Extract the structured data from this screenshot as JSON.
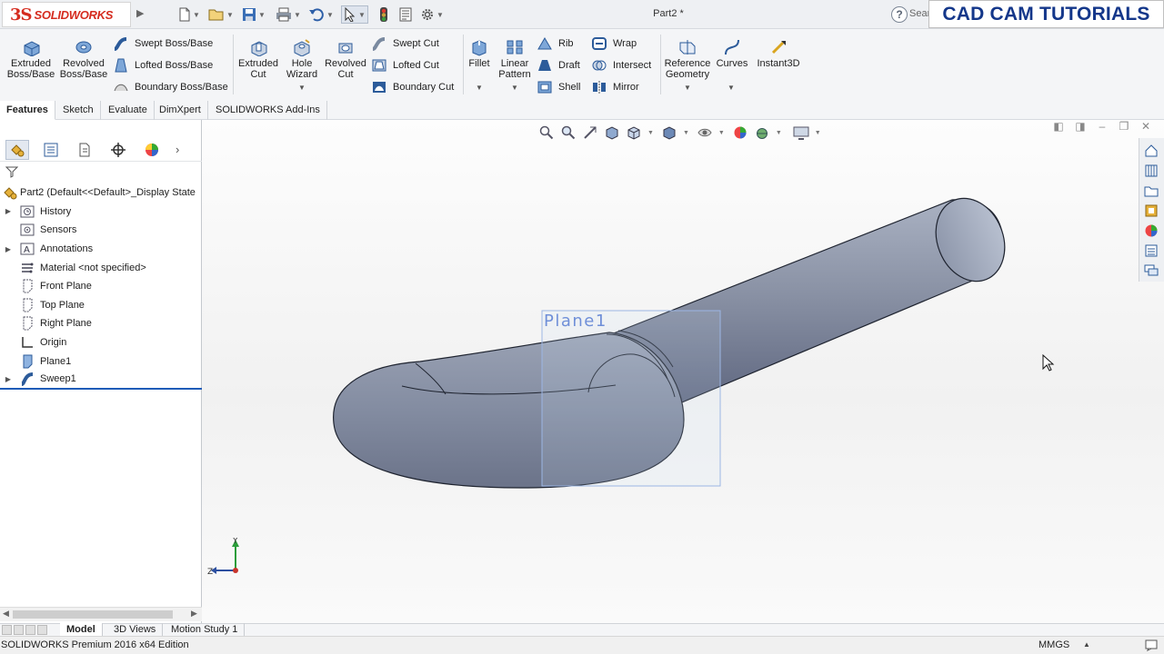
{
  "titlebar": {
    "logo_ds": "3S",
    "logo_name": "SOLIDWORKS",
    "document_title": "Part2 *",
    "search_text": "Sear",
    "banner": "CAD CAM TUTORIALS"
  },
  "ribbon": {
    "extruded_boss": [
      "Extruded",
      "Boss/Base"
    ],
    "revolved_boss": [
      "Revolved",
      "Boss/Base"
    ],
    "swept_boss": "Swept Boss/Base",
    "lofted_boss": "Lofted Boss/Base",
    "boundary_boss": "Boundary Boss/Base",
    "extruded_cut": [
      "Extruded",
      "Cut"
    ],
    "hole_wizard": [
      "Hole",
      "Wizard"
    ],
    "revolved_cut": [
      "Revolved",
      "Cut"
    ],
    "swept_cut": "Swept Cut",
    "lofted_cut": "Lofted Cut",
    "boundary_cut": "Boundary Cut",
    "fillet": "Fillet",
    "linear_pattern": [
      "Linear",
      "Pattern"
    ],
    "rib": "Rib",
    "draft": "Draft",
    "shell": "Shell",
    "wrap": "Wrap",
    "intersect": "Intersect",
    "mirror": "Mirror",
    "reference_geometry": [
      "Reference",
      "Geometry"
    ],
    "curves": "Curves",
    "instant3d": "Instant3D"
  },
  "tabs": [
    "Features",
    "Sketch",
    "Evaluate",
    "DimXpert",
    "SOLIDWORKS Add-Ins"
  ],
  "tree": {
    "root": "Part2  (Default<<Default>_Display State",
    "items": [
      {
        "label": "History",
        "icon": "history-folder-icon",
        "expandable": true
      },
      {
        "label": "Sensors",
        "icon": "sensors-icon",
        "expandable": false
      },
      {
        "label": "Annotations",
        "icon": "annotations-icon",
        "expandable": true
      },
      {
        "label": "Material <not specified>",
        "icon": "material-icon",
        "expandable": false
      },
      {
        "label": "Front Plane",
        "icon": "plane-icon",
        "expandable": false
      },
      {
        "label": "Top Plane",
        "icon": "plane-icon",
        "expandable": false
      },
      {
        "label": "Right Plane",
        "icon": "plane-icon",
        "expandable": false
      },
      {
        "label": "Origin",
        "icon": "origin-icon",
        "expandable": false
      },
      {
        "label": "Plane1",
        "icon": "plane-blue-icon",
        "expandable": false
      },
      {
        "label": "Sweep1",
        "icon": "sweep-icon",
        "expandable": true
      }
    ]
  },
  "viewport": {
    "plane_label": "Plane1",
    "triad_x": "Z",
    "triad_y": "Y"
  },
  "bottom_tabs": [
    "Model",
    "3D Views",
    "Motion Study 1"
  ],
  "status": {
    "edition": "SOLIDWORKS Premium 2016 x64 Edition",
    "units": "MMGS"
  },
  "colors": {
    "accent_blue": "#1e5bb8",
    "brand_red": "#d52b1e",
    "banner_text": "#14378a",
    "model_gray": "#8a93a6"
  }
}
